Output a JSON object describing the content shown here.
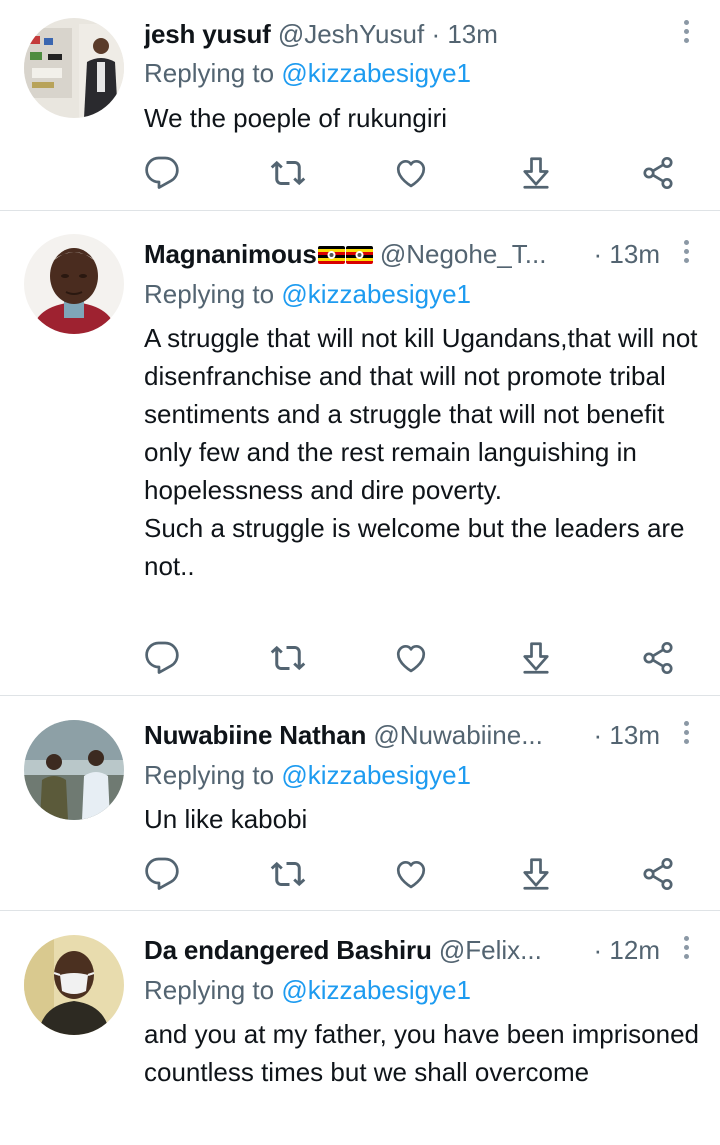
{
  "replying_prefix": "Replying to",
  "replying_handle": "@kizzabesigye1",
  "colors": {
    "accent": "#1d9bf0",
    "secondary_text": "#536471",
    "divider": "#dfe3e6"
  },
  "icons": [
    "reply-icon",
    "retweet-icon",
    "like-icon",
    "download-share-icon",
    "share-icon",
    "more-options-icon"
  ],
  "tweets": [
    {
      "name": "jesh yusuf",
      "handle": "@JeshYusuf",
      "time": "· 13m",
      "body": [
        "We the poeple of rukungiri"
      ]
    },
    {
      "name": "Magnanimous",
      "name_flags": [
        "uganda-flag",
        "uganda-flag"
      ],
      "handle": "@Negohe_T...",
      "time": "· 13m",
      "body": [
        "A struggle that will not kill Ugandans,that will not disenfranchise and that will not promote tribal sentiments and a struggle that will not benefit only few and the rest remain languishing in hopelessness and dire poverty.",
        "Such a struggle is welcome but the leaders are not.."
      ]
    },
    {
      "name": "Nuwabiine Nathan",
      "handle": "@Nuwabiine...",
      "time": "· 13m",
      "body": [
        "Un like kabobi"
      ]
    },
    {
      "name": "Da endangered Bashiru",
      "handle": "@Felix...",
      "time": "· 12m",
      "body": [
        "and you at my father, you have been imprisoned countless times but we shall overcome"
      ]
    }
  ]
}
